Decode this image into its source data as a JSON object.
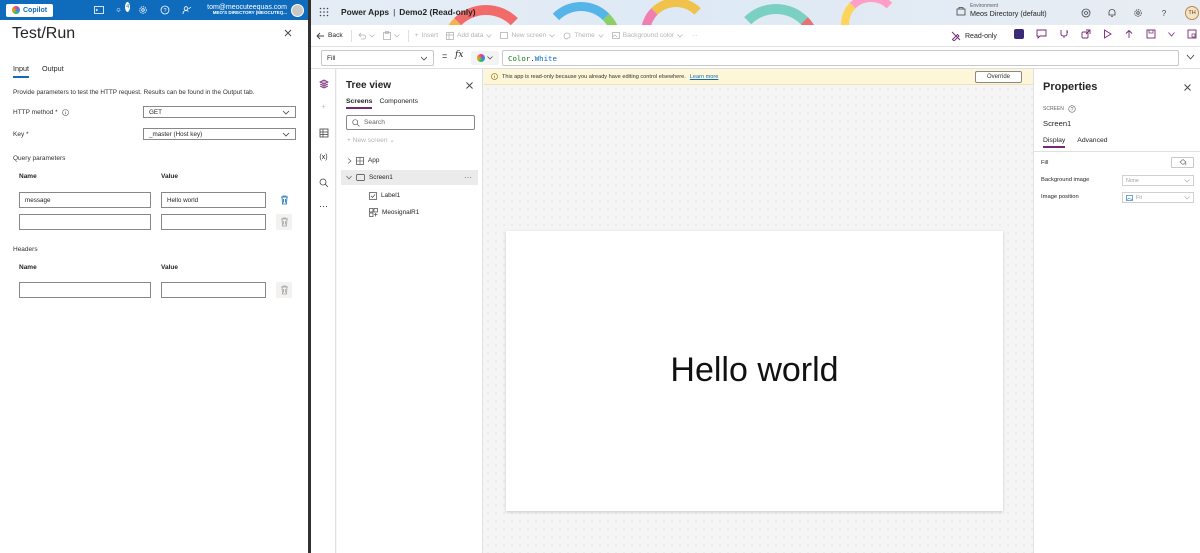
{
  "azure": {
    "copilot_label": "Copilot",
    "notification_count": "4",
    "user_email": "tom@meocuteequas.com",
    "user_directory": "MEO'S DIRECTORY (MEOCUTEQ..."
  },
  "test_run": {
    "title": "Test/Run",
    "tabs": [
      "Input",
      "Output"
    ],
    "description": "Provide parameters to test the HTTP request. Results can be found in the Output tab.",
    "http_method_label": "HTTP method *",
    "http_method_value": "GET",
    "key_label": "Key *",
    "key_value": "_master (Host key)",
    "query_section": "Query parameters",
    "name_header": "Name",
    "value_header": "Value",
    "query_rows": [
      {
        "name": "message",
        "value": "Hello world"
      },
      {
        "name": "",
        "value": ""
      }
    ],
    "headers_section": "Headers",
    "header_rows": [
      {
        "name": "",
        "value": ""
      }
    ]
  },
  "powerapps": {
    "app_name": "Power Apps",
    "separator": "|",
    "doc_title": "Demo2 (Read-only)",
    "environment_label": "Environment",
    "environment_value": "Meos Directory (default)",
    "avatar_initials": "TH",
    "commands": {
      "back": "Back",
      "insert": "Insert",
      "add_data": "Add data",
      "new_screen": "New screen",
      "theme": "Theme",
      "background_color": "Background color",
      "more": "···",
      "read_only": "Read-only"
    },
    "formula": {
      "property": "Fill",
      "eq": "=",
      "fx": "fx",
      "expr_obj": "Color",
      "expr_dot": ".",
      "expr_member": "White"
    }
  },
  "tree_view": {
    "title": "Tree view",
    "tabs": [
      "Screens",
      "Components"
    ],
    "search_placeholder": "Search",
    "new_screen": "+ New screen ⌄",
    "nodes": {
      "app": "App",
      "screen1": "Screen1",
      "label1": "Label1",
      "control2": "MeosignalR1"
    }
  },
  "canvas": {
    "banner_text": "This app is read-only because you already have editing control elsewhere.",
    "banner_link": "Learn more",
    "override_label": "Override",
    "label_text": "Hello world"
  },
  "properties": {
    "title": "Properties",
    "type": "SCREEN",
    "name": "Screen1",
    "tabs": [
      "Display",
      "Advanced"
    ],
    "rows": {
      "fill": "Fill",
      "background_image": "Background image",
      "background_image_value": "None",
      "image_position": "Image position",
      "image_position_value": "Fit"
    }
  }
}
